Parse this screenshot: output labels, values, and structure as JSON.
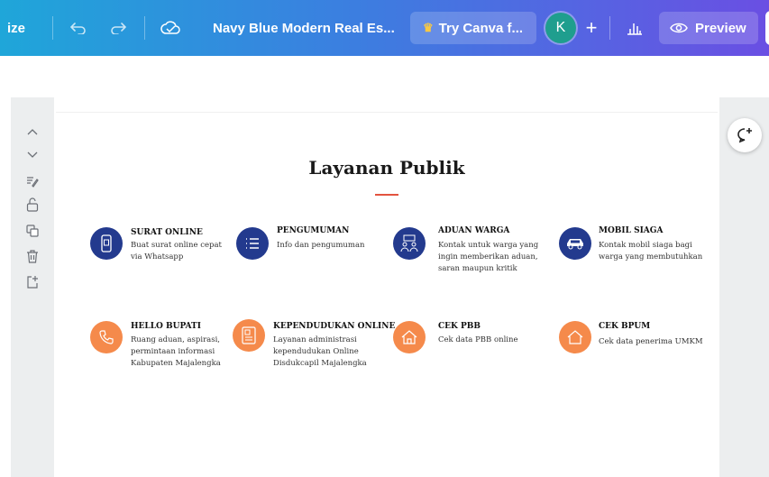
{
  "topbar": {
    "resize_label": "ize",
    "doc_title": "Navy Blue Modern Real Es...",
    "try_canva_label": "Try Canva f...",
    "avatar_initial": "K",
    "preview_label": "Preview"
  },
  "colors": {
    "navy": "#233a8e",
    "orange": "#f58a4b",
    "accent_red": "#e3533f"
  },
  "canvas": {
    "title": "Layanan Publik",
    "services": [
      {
        "title": "SURAT ONLINE",
        "desc": "Buat surat online cepat\nvia Whatsapp",
        "icon": "phone-doc-icon",
        "color": "navy"
      },
      {
        "title": "PENGUMUMAN",
        "desc": "Info dan pengumuman",
        "icon": "list-icon",
        "color": "navy"
      },
      {
        "title": "ADUAN WARGA",
        "desc": "Kontak untuk warga yang\ningin memberikan aduan,\nsaran maupun kritik",
        "icon": "people-icon",
        "color": "navy"
      },
      {
        "title": "MOBIL SIAGA",
        "desc": "Kontak mobil siaga bagi\nwarga yang membutuhkan",
        "icon": "car-icon",
        "color": "navy"
      },
      {
        "title": "HELLO BUPATI",
        "desc": "Ruang aduan, aspirasi,\npermintaan informasi\nKabupaten Majalengka",
        "icon": "phone-icon",
        "color": "orange"
      },
      {
        "title": "KEPENDUDUKAN ONLINE",
        "desc": "Layanan administrasi\nkependudukan Online\nDisdukcapil Majalengka",
        "icon": "id-card-icon",
        "color": "orange"
      },
      {
        "title": "CEK PBB",
        "desc": "Cek data PBB online",
        "icon": "house-icon",
        "color": "orange"
      },
      {
        "title": "CEK BPUM",
        "desc": "Cek data penerima UMKM",
        "icon": "house-icon",
        "color": "orange"
      }
    ]
  }
}
